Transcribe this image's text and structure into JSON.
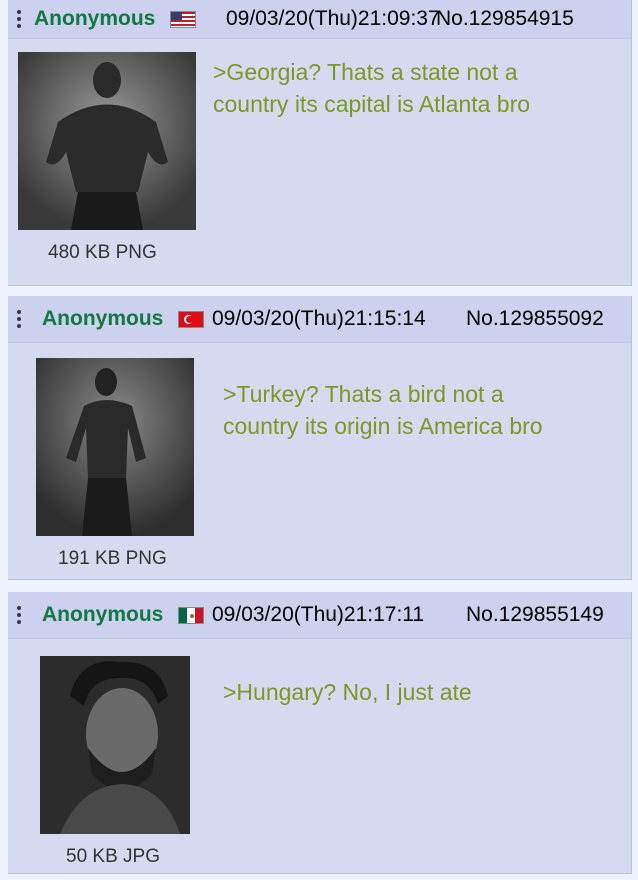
{
  "posts": [
    {
      "name": "Anonymous",
      "flag": "us-flag-icon",
      "datetime": "09/03/20(Thu)21:09:37",
      "number": "No.129854915",
      "file_info": "480 KB PNG",
      "thumbnail": "muscular-man-photo",
      "text": ">Georgia? Thats a state not a\ncountry its capital is Atlanta bro"
    },
    {
      "name": "Anonymous",
      "flag": "turkey-flag-icon",
      "datetime": "09/03/20(Thu)21:15:14",
      "number": "No.129855092",
      "file_info": "191 KB PNG",
      "thumbnail": "muscular-man-photo",
      "text": ">Turkey? Thats a bird not a\ncountry its origin is America bro"
    },
    {
      "name": "Anonymous",
      "flag": "mexico-flag-icon",
      "datetime": "09/03/20(Thu)21:17:11",
      "number": "No.129855149",
      "file_info": "50 KB JPG",
      "thumbnail": "man-portrait-photo",
      "text": ">Hungary? No, I just ate"
    }
  ],
  "colors": {
    "post_background": "#d6daf0",
    "name": "#117743",
    "greentext": "#789922"
  }
}
